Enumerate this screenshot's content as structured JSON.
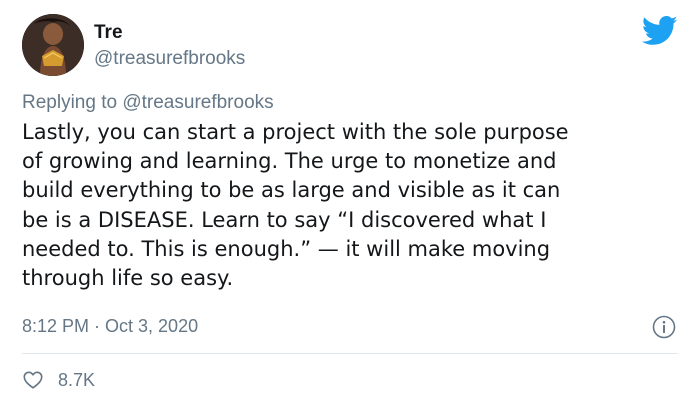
{
  "tweet": {
    "author": {
      "display_name": "Tre",
      "handle": "@treasurefbrooks"
    },
    "replying_to": {
      "prefix": "Replying to",
      "mention": "@treasurefbrooks"
    },
    "text_lines": [
      "Lastly, you can start a project with the sole purpose",
      "of growing and learning. The urge to monetize and",
      "build everything to be as large and visible as it can",
      "be is a DISEASE. Learn to say “I discovered what I",
      "needed to. This is enough.” — it will make moving",
      "through life so easy."
    ],
    "timestamp": "8:12 PM · Oct 3, 2020",
    "likes": "8.7K"
  },
  "colors": {
    "twitter_blue": "#1da1f2",
    "secondary_text": "#657786",
    "primary_text": "#14171a",
    "divider": "#e1e8ed"
  },
  "icons": {
    "brand": "twitter-bird-icon",
    "info": "info-icon",
    "like": "heart-icon"
  }
}
